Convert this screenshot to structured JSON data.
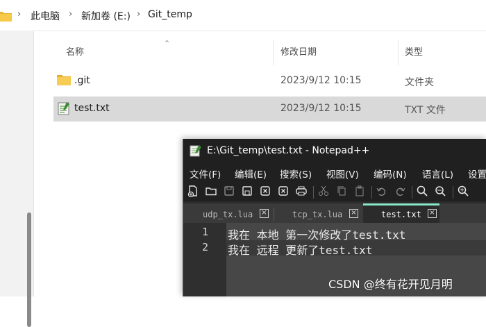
{
  "explorer": {
    "breadcrumb": [
      "此电脑",
      "新加卷 (E:)",
      "Git_temp"
    ],
    "columns": {
      "name": "名称",
      "date": "修改日期",
      "type": "类型"
    },
    "files": [
      {
        "name": ".git",
        "date": "2023/9/12 10:15",
        "type": "文件夹",
        "icon": "folder-icon"
      },
      {
        "name": "test.txt",
        "date": "2023/9/12 10:15",
        "type": "TXT 文件",
        "icon": "text-file-icon"
      }
    ]
  },
  "notepad": {
    "title": "E:\\Git_temp\\test.txt - Notepad++",
    "menu": [
      "文件(F)",
      "编辑(E)",
      "搜索(S)",
      "视图(V)",
      "编码(N)",
      "语言(L)",
      "设置"
    ],
    "tabs": [
      {
        "label": "udp_tx.lua",
        "active": false
      },
      {
        "label": "tcp_tx.lua",
        "active": false
      },
      {
        "label": "test.txt",
        "active": true
      }
    ],
    "lines": [
      {
        "num": "1",
        "text": "我在 本地 第一次修改了test.txt"
      },
      {
        "num": "2",
        "text": "我在 远程 更新了test.txt"
      }
    ],
    "active_tab_color": "#87e8c7"
  },
  "watermark": "CSDN @终有花开见月明"
}
